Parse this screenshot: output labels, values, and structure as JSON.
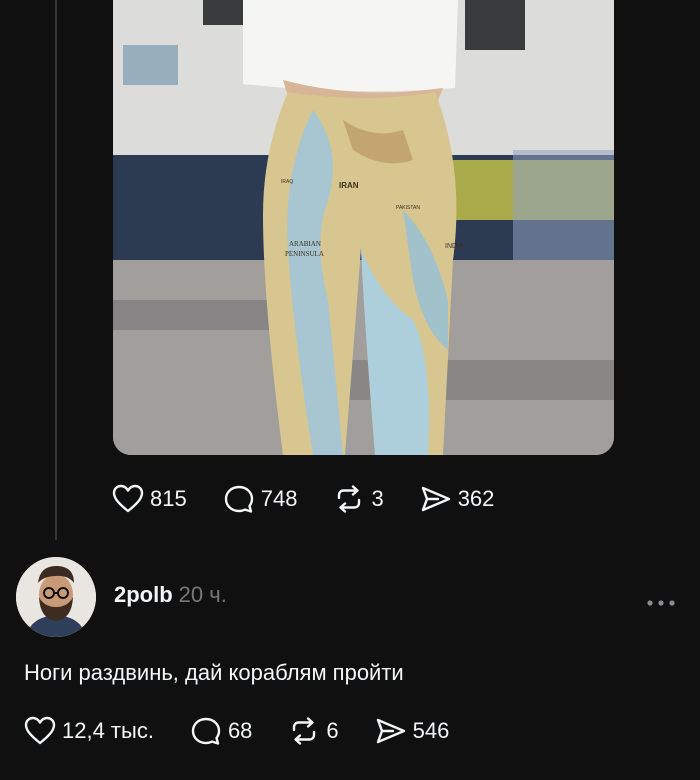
{
  "post": {
    "image_alt": "Leggings with world map print",
    "map_labels": {
      "iran": "IRAN",
      "arabian1": "ARABIAN",
      "arabian2": "PENINSULA",
      "india": "INDIA",
      "pakistan": "PAKISTAN",
      "iraq": "IRAQ"
    },
    "stats": {
      "likes": "815",
      "comments": "748",
      "reposts": "3",
      "shares": "362"
    }
  },
  "reply": {
    "username": "2polb",
    "time": "20 ч.",
    "text": "Ноги раздвинь, дай кораблям пройти",
    "stats": {
      "likes": "12,4 тыс.",
      "comments": "68",
      "reposts": "6",
      "shares": "546"
    }
  }
}
